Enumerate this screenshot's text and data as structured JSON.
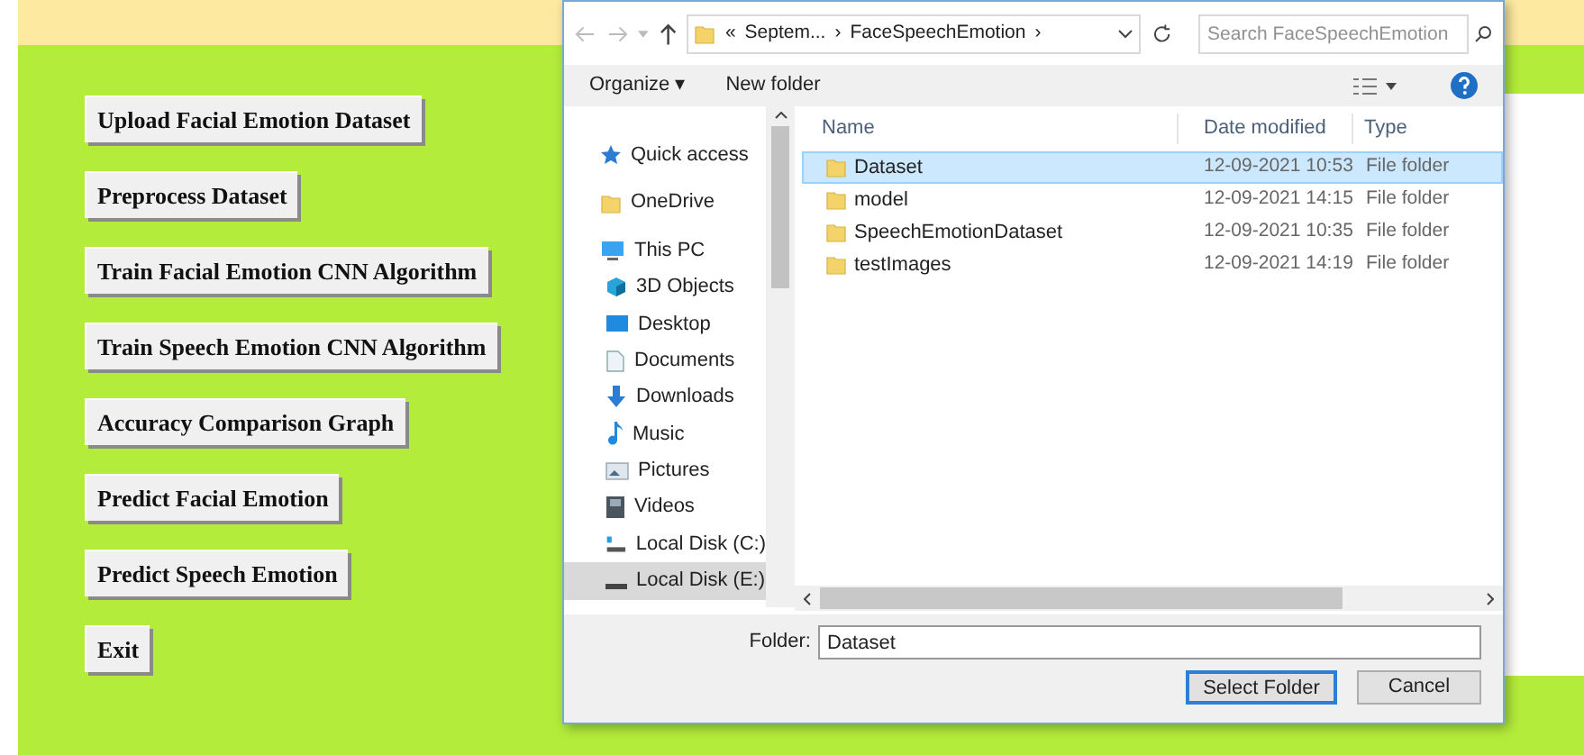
{
  "app": {
    "buttons": [
      "Upload Facial Emotion Dataset",
      "Preprocess Dataset",
      "Train Facial Emotion CNN Algorithm",
      "Train Speech Emotion CNN Algorithm",
      "Accuracy Comparison Graph",
      "Predict Facial Emotion",
      "Predict Speech Emotion",
      "Exit"
    ]
  },
  "dialog": {
    "breadcrumb": [
      "«",
      "Septem...",
      "›",
      "FaceSpeechEmotion",
      "›"
    ],
    "search": {
      "placeholder": "Search FaceSpeechEmotion"
    },
    "toolbar": {
      "organize": "Organize ▾",
      "new_folder": "New folder"
    },
    "nav": [
      {
        "kind": "star",
        "label": "Quick access",
        "selected": false
      },
      {
        "kind": "folder",
        "label": "OneDrive",
        "selected": false
      },
      {
        "kind": "pc",
        "label": "This PC",
        "selected": false
      },
      {
        "kind": "cube",
        "label": "3D Objects",
        "selected": false
      },
      {
        "kind": "desktop",
        "label": "Desktop",
        "selected": false
      },
      {
        "kind": "doc",
        "label": "Documents",
        "selected": false
      },
      {
        "kind": "download",
        "label": "Downloads",
        "selected": false
      },
      {
        "kind": "music",
        "label": "Music",
        "selected": false
      },
      {
        "kind": "pictures",
        "label": "Pictures",
        "selected": false
      },
      {
        "kind": "video",
        "label": "Videos",
        "selected": false
      },
      {
        "kind": "disk",
        "label": "Local Disk (C:)",
        "selected": false
      },
      {
        "kind": "drive",
        "label": "Local Disk (E:)",
        "selected": true
      }
    ],
    "columns": [
      "Name",
      "Date modified",
      "Type"
    ],
    "files": [
      {
        "name": "Dataset",
        "date": "12-09-2021 10:53",
        "type": "File folder",
        "selected": true
      },
      {
        "name": "model",
        "date": "12-09-2021 14:15",
        "type": "File folder",
        "selected": false
      },
      {
        "name": "SpeechEmotionDataset",
        "date": "12-09-2021 10:35",
        "type": "File folder",
        "selected": false
      },
      {
        "name": "testImages",
        "date": "12-09-2021 14:19",
        "type": "File folder",
        "selected": false
      }
    ],
    "folder_label": "Folder:",
    "folder_value": "Dataset",
    "select_button": "Select Folder",
    "cancel_button": "Cancel"
  }
}
